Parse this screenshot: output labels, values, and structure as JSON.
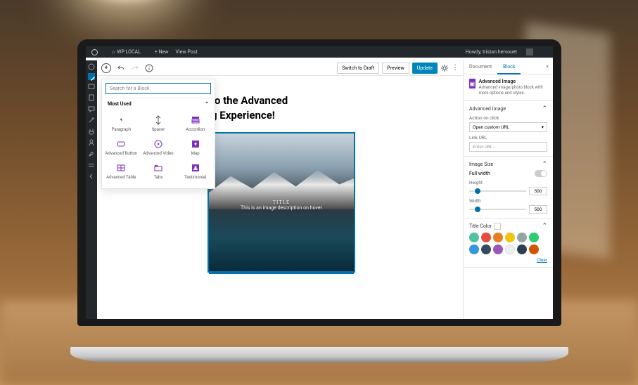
{
  "admin": {
    "site": "WP LOCAL",
    "new": "+ New",
    "view": "View Post",
    "howdy": "Howdy, tristan.hervouet"
  },
  "toolbar": {
    "draft": "Switch to Draft",
    "preview": "Preview",
    "update": "Update"
  },
  "title": {
    "line1": "to the Advanced",
    "line2": "g Experience!"
  },
  "hero": {
    "title": "TITLE",
    "desc": "This is an image description on hover"
  },
  "inserter": {
    "placeholder": "Search for a Block",
    "cat": "Most Used",
    "blocks": [
      "Paragraph",
      "Spacer",
      "Accordion",
      "Advanced Button",
      "Advanced Video",
      "Map",
      "Advanced Table",
      "Tabs",
      "Testimonial"
    ]
  },
  "sidebar": {
    "tabs": {
      "doc": "Document",
      "block": "Block"
    },
    "blockInfo": {
      "name": "Advanced Image",
      "desc": "Advanced image/photo block with more options and styles."
    },
    "p1": {
      "title": "Advanced Image",
      "actionLbl": "Action on click",
      "actionVal": "Open custom URL",
      "urlLbl": "Link URL",
      "urlPh": "Enter URL..."
    },
    "p2": {
      "title": "Image Size",
      "full": "Full width",
      "height": "Height",
      "width": "Width",
      "val": "500"
    },
    "p3": {
      "title": "Title Color",
      "clear": "Clear"
    },
    "colors": [
      "#4fc3a1",
      "#e74c3c",
      "#e67e22",
      "#f1c40f",
      "#95a5a6",
      "#2ecc71",
      "#3498db",
      "#34495e",
      "#9b59b6",
      "#ecf0f1",
      "#2c3e50",
      "#d35400"
    ]
  }
}
